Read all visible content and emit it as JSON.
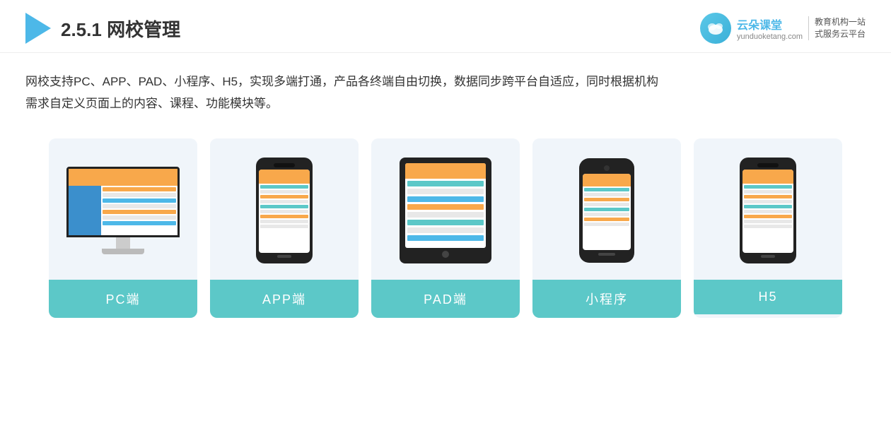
{
  "header": {
    "section_number": "2.5.1",
    "title_plain": "网校管理",
    "brand": {
      "name": "云朵课堂",
      "url": "yunduoketang.com",
      "tagline_line1": "教育机构一站",
      "tagline_line2": "式服务云平台"
    }
  },
  "description": {
    "line1": "网校支持PC、APP、PAD、小程序、H5，实现多端打通，产品各终端自由切换，数据同步跨平台自适应，同时根据机构",
    "line2": "需求自定义页面上的内容、课程、功能模块等。"
  },
  "cards": [
    {
      "id": "pc",
      "label": "PC端",
      "device": "monitor"
    },
    {
      "id": "app",
      "label": "APP端",
      "device": "phone"
    },
    {
      "id": "pad",
      "label": "PAD端",
      "device": "tablet"
    },
    {
      "id": "miniprogram",
      "label": "小程序",
      "device": "mini-phone"
    },
    {
      "id": "h5",
      "label": "H5",
      "device": "phone2"
    }
  ]
}
